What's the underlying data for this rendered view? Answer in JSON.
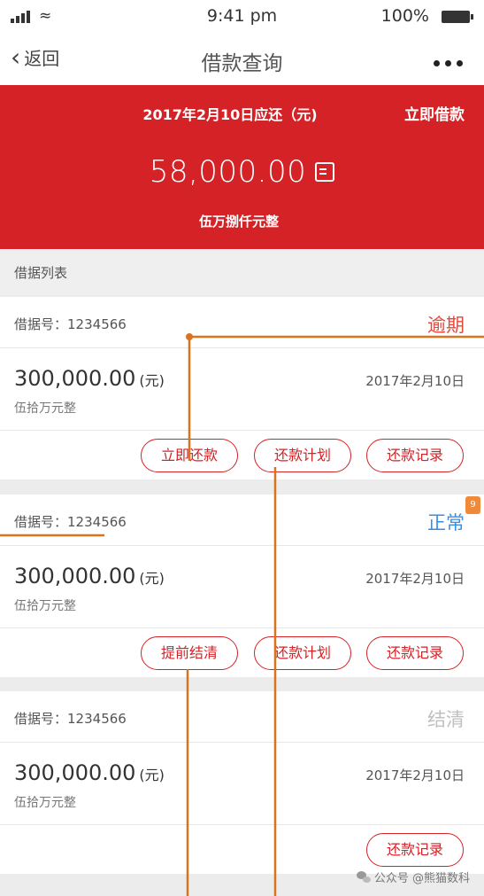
{
  "status_bar": {
    "time": "9:41 pm",
    "battery": "100%"
  },
  "nav": {
    "back_label": "返回",
    "title": "借款查询"
  },
  "hero": {
    "due_label": "2017年2月10日应还（元)",
    "borrow_now": "立即借款",
    "amount": "58,000.00",
    "amount_cn": "伍万捌仟元整"
  },
  "list": {
    "header": "借据列表",
    "loan_no_prefix": "借据号：",
    "cards": [
      {
        "loan_no": "1234566",
        "status": "逾期",
        "status_color": "#e04a3a",
        "amount": "300,000.00",
        "unit": "(元)",
        "amount_cn": "伍拾万元整",
        "date": "2017年2月10日",
        "actions": [
          "立即还款",
          "还款计划",
          "还款记录"
        ]
      },
      {
        "loan_no": "1234566",
        "status": "正常",
        "status_color": "#3a8ee0",
        "badge": "9",
        "amount": "300,000.00",
        "unit": "(元)",
        "amount_cn": "伍拾万元整",
        "date": "2017年2月10日",
        "actions": [
          "提前结清",
          "还款计划",
          "还款记录"
        ]
      },
      {
        "loan_no": "1234566",
        "status": "结清",
        "status_color": "#c0c0c0",
        "amount": "300,000.00",
        "unit": "(元)",
        "amount_cn": "伍拾万元整",
        "date": "2017年2月10日",
        "actions": [
          "还款记录"
        ]
      }
    ]
  },
  "watermark": "公众号 @熊猫数科",
  "colors": {
    "brand_red": "#d42227",
    "annotation_orange": "#d9731f"
  }
}
